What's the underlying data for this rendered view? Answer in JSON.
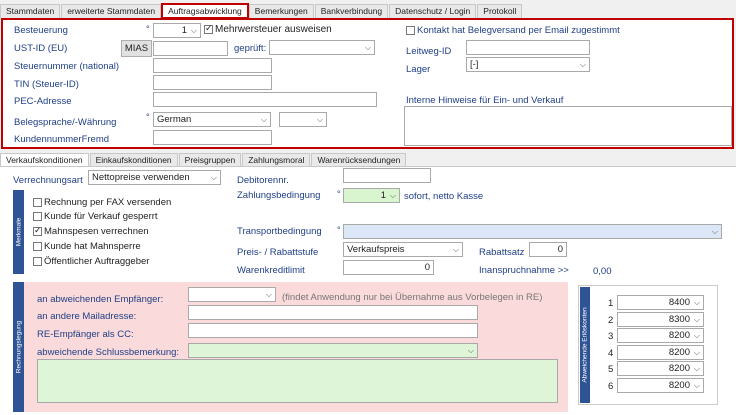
{
  "top_tabs": [
    "Stammdaten",
    "erweiterte Stammdaten",
    "Auftragsabwicklung",
    "Bemerkungen",
    "Bankverbindung",
    "Datenschutz / Login",
    "Protokoll"
  ],
  "fields": {
    "besteuerung": "Besteuerung",
    "besteuerung_val": "1",
    "mwst": "Mehrwersteuer ausweisen",
    "ust": "UST-ID (EU)",
    "mias": "MIAS",
    "geprueft": "geprüft:",
    "steuer": "Steuernummer (national)",
    "tin": "TIN (Steuer-ID)",
    "pec": "PEC-Adresse",
    "sprache": "Belegsprache/-Währung",
    "sprache_val": "German",
    "kdnr": "KundennummerFremd",
    "kontakt": "Kontakt hat Belegversand per Email zugestimmt",
    "leitweg": "Leitweg-ID",
    "lager": "Lager",
    "lager_val": "[-]",
    "hinweise": "Interne Hinweise für Ein- und Verkauf"
  },
  "sub_tabs": [
    "Verkaufskonditionen",
    "Einkaufskonditionen",
    "Preisgruppen",
    "Zahlungsmoral",
    "Warenrücksendungen"
  ],
  "vk": {
    "verrechnungsart": "Verrechnungsart",
    "verrechnungsart_val": "Nettopreise verwenden",
    "merkmale": "Merkmale",
    "cb1": "Rechnung per FAX versenden",
    "cb2": "Kunde für Verkauf gesperrt",
    "cb3": "Mahnspesen verrechnen",
    "cb4": "Kunde hat Mahnsperre",
    "cb5": "Öffentlicher Auftraggeber",
    "debitor": "Debitorennr.",
    "zahlung": "Zahlungsbedingung",
    "zahlung_val": "1",
    "zahlung_text": "sofort, netto Kasse",
    "transport": "Transportbedingung",
    "preisstufe": "Preis- / Rabattstufe",
    "preisstufe_val": "Verkaufspreis",
    "rabattsatz": "Rabattsatz",
    "rabattsatz_val": "0",
    "warenkredit": "Warenkreditlimit",
    "warenkredit_val": "0",
    "inanspruch": "Inanspruchnahme >>",
    "inanspruch_val": "0,00"
  },
  "rech": {
    "band": "Rechnungslegung",
    "empfaenger": "an abweichenden Empfänger:",
    "hint": "(findet Anwendung nur bei Übernahme aus Vorbelegen in RE)",
    "mail": "an andere Mailadresse:",
    "cc": "RE-Empfänger als CC:",
    "schluss": "abweichende Schlussbemerkung:"
  },
  "erloes": {
    "band": "Abweichende Erlöskonten",
    "rows": [
      {
        "n": "1",
        "v": "8400"
      },
      {
        "n": "2",
        "v": "8300"
      },
      {
        "n": "3",
        "v": "8200"
      },
      {
        "n": "4",
        "v": "8200"
      },
      {
        "n": "5",
        "v": "8200"
      },
      {
        "n": "6",
        "v": "8200"
      }
    ]
  }
}
